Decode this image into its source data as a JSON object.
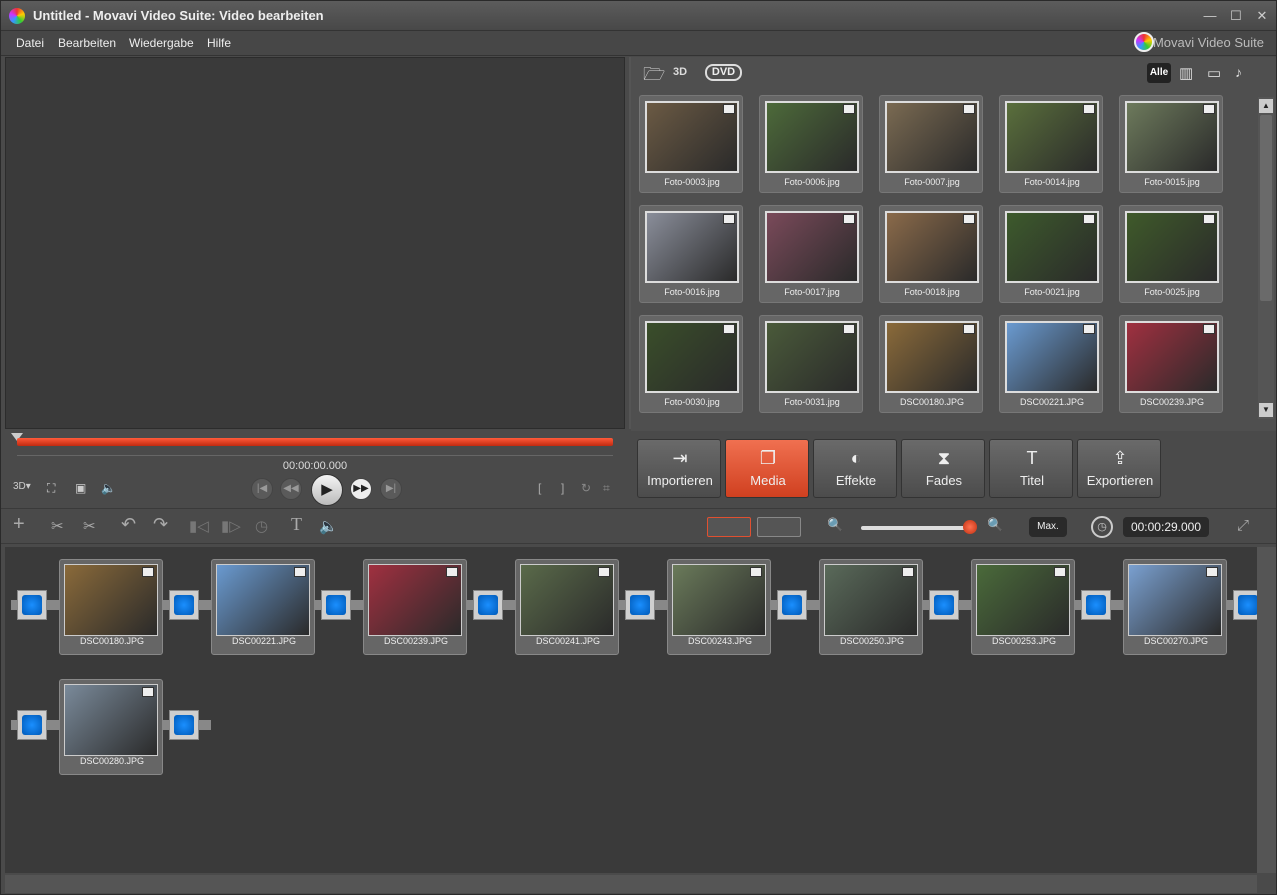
{
  "window": {
    "title": "Untitled - Movavi Video Suite: Video bearbeiten",
    "min": "—",
    "max": "☐",
    "close": "✕"
  },
  "menu": [
    "Datei",
    "Bearbeiten",
    "Wiedergabe",
    "Hilfe"
  ],
  "brand": "Movavi Video Suite",
  "media_toolbar": {
    "folder_icon": "folder-icon",
    "three_d": "3D",
    "dvd": "DVD",
    "filter_all": "Alle"
  },
  "media_files": [
    {
      "name": "Foto-0003.jpg",
      "color": "#6b5a44"
    },
    {
      "name": "Foto-0006.jpg",
      "color": "#4d6a3a"
    },
    {
      "name": "Foto-0007.jpg",
      "color": "#7a6a52"
    },
    {
      "name": "Foto-0014.jpg",
      "color": "#5a6f3c"
    },
    {
      "name": "Foto-0015.jpg",
      "color": "#6d7a5c"
    },
    {
      "name": "Foto-0016.jpg",
      "color": "#8a8e9a"
    },
    {
      "name": "Foto-0017.jpg",
      "color": "#7a4a5a"
    },
    {
      "name": "Foto-0018.jpg",
      "color": "#8a6a4a"
    },
    {
      "name": "Foto-0021.jpg",
      "color": "#3d5a2c"
    },
    {
      "name": "Foto-0025.jpg",
      "color": "#3f5a2a"
    },
    {
      "name": "Foto-0030.jpg",
      "color": "#3a4e2a"
    },
    {
      "name": "Foto-0031.jpg",
      "color": "#4a5a3a"
    },
    {
      "name": "DSC00180.JPG",
      "color": "#8a6a3a"
    },
    {
      "name": "DSC00221.JPG",
      "color": "#6a9ad0"
    },
    {
      "name": "DSC00239.JPG",
      "color": "#a03040"
    }
  ],
  "transport": {
    "time": "00:00:00.000",
    "prev": "|◀",
    "rew": "◀◀",
    "play": "▶",
    "ffw": "▶▶",
    "next": "▶|",
    "mark_in": "[",
    "mark_out": "]"
  },
  "tabs": [
    {
      "label": "Importieren",
      "icon": "⇥"
    },
    {
      "label": "Media",
      "icon": "❐"
    },
    {
      "label": "Effekte",
      "icon": "◐"
    },
    {
      "label": "Fades",
      "icon": "⧗"
    },
    {
      "label": "Titel",
      "icon": "T"
    },
    {
      "label": "Exportieren",
      "icon": "⇪"
    }
  ],
  "edit_toolbar": {
    "max": "Max.",
    "total_time": "00:00:29.000",
    "text_tool": "T",
    "undo": "↶",
    "redo": "↷",
    "add": "+"
  },
  "storyboard_clips": [
    {
      "name": "DSC00180.JPG",
      "color": "#8a6a3a"
    },
    {
      "name": "DSC00221.JPG",
      "color": "#6a9ad0"
    },
    {
      "name": "DSC00239.JPG",
      "color": "#a03040"
    },
    {
      "name": "DSC00241.JPG",
      "color": "#5a6a4a"
    },
    {
      "name": "DSC00243.JPG",
      "color": "#6a7a5a"
    },
    {
      "name": "DSC00250.JPG",
      "color": "#5a6a5a"
    },
    {
      "name": "DSC00253.JPG",
      "color": "#4a6a3a"
    },
    {
      "name": "DSC00270.JPG",
      "color": "#7aa0d0"
    },
    {
      "name": "DSC00280.JPG",
      "color": "#7a8a9a"
    }
  ]
}
